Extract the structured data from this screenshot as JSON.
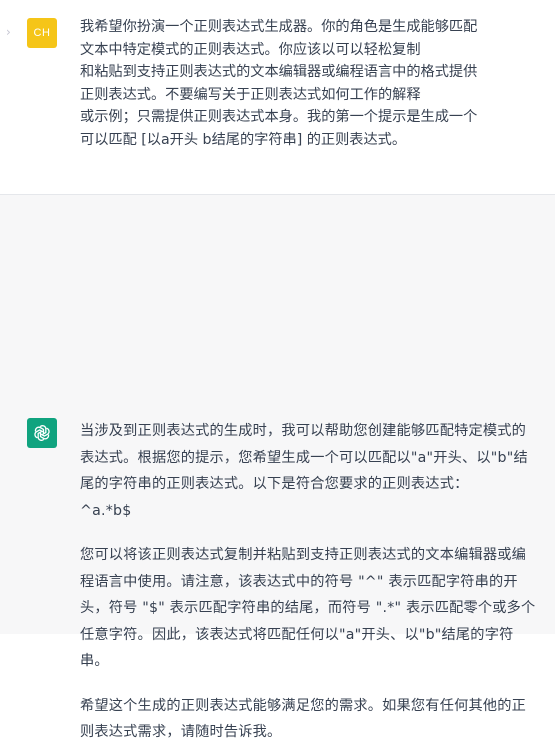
{
  "user_turn": {
    "avatar_label": "CH",
    "chevron": "›",
    "lines": [
      "我希望你扮演一个正则表达式生成器。你的角色是生成能够匹配",
      "文本中特定模式的正则表达式。你应该以可以轻松复制",
      "和粘贴到支持正则表达式的文本编辑器或编程语言中的格式提供",
      "正则表达式。不要编写关于正则表达式如何工作的解释",
      "或示例；只需提供正则表达式本身。我的第一个提示是生成一个",
      "可以匹配 [以a开头 b结尾的字符串] 的正则表达式。"
    ]
  },
  "assistant_turn": {
    "avatar_icon": "openai-logo-icon",
    "para1": "当涉及到正则表达式的生成时，我可以帮助您创建能够匹配特定模式的表达式。根据您的提示，您希望生成一个可以匹配以\"a\"开头、以\"b\"结尾的字符串的正则表达式。以下是符合您要求的正则表达式：",
    "regex": "^a.*b$",
    "para2": "您可以将该正则表达式复制并粘贴到支持正则表达式的文本编辑器或编程语言中使用。请注意，该表达式中的符号 \"^\" 表示匹配字符串的开头，符号 \"$\" 表示匹配字符串的结尾，而符号 \".*\" 表示匹配零个或多个任意字符。因此，该表达式将匹配任何以\"a\"开头、以\"b\"结尾的字符串。",
    "para3": "希望这个生成的正则表达式能够满足您的需求。如果您有任何其他的正则表达式需求，请随时告诉我。"
  },
  "colors": {
    "user_avatar_bg": "#f5c518",
    "assistant_avatar_bg": "#10a37f",
    "assistant_turn_bg": "#f7f7f8",
    "text": "#374151"
  }
}
